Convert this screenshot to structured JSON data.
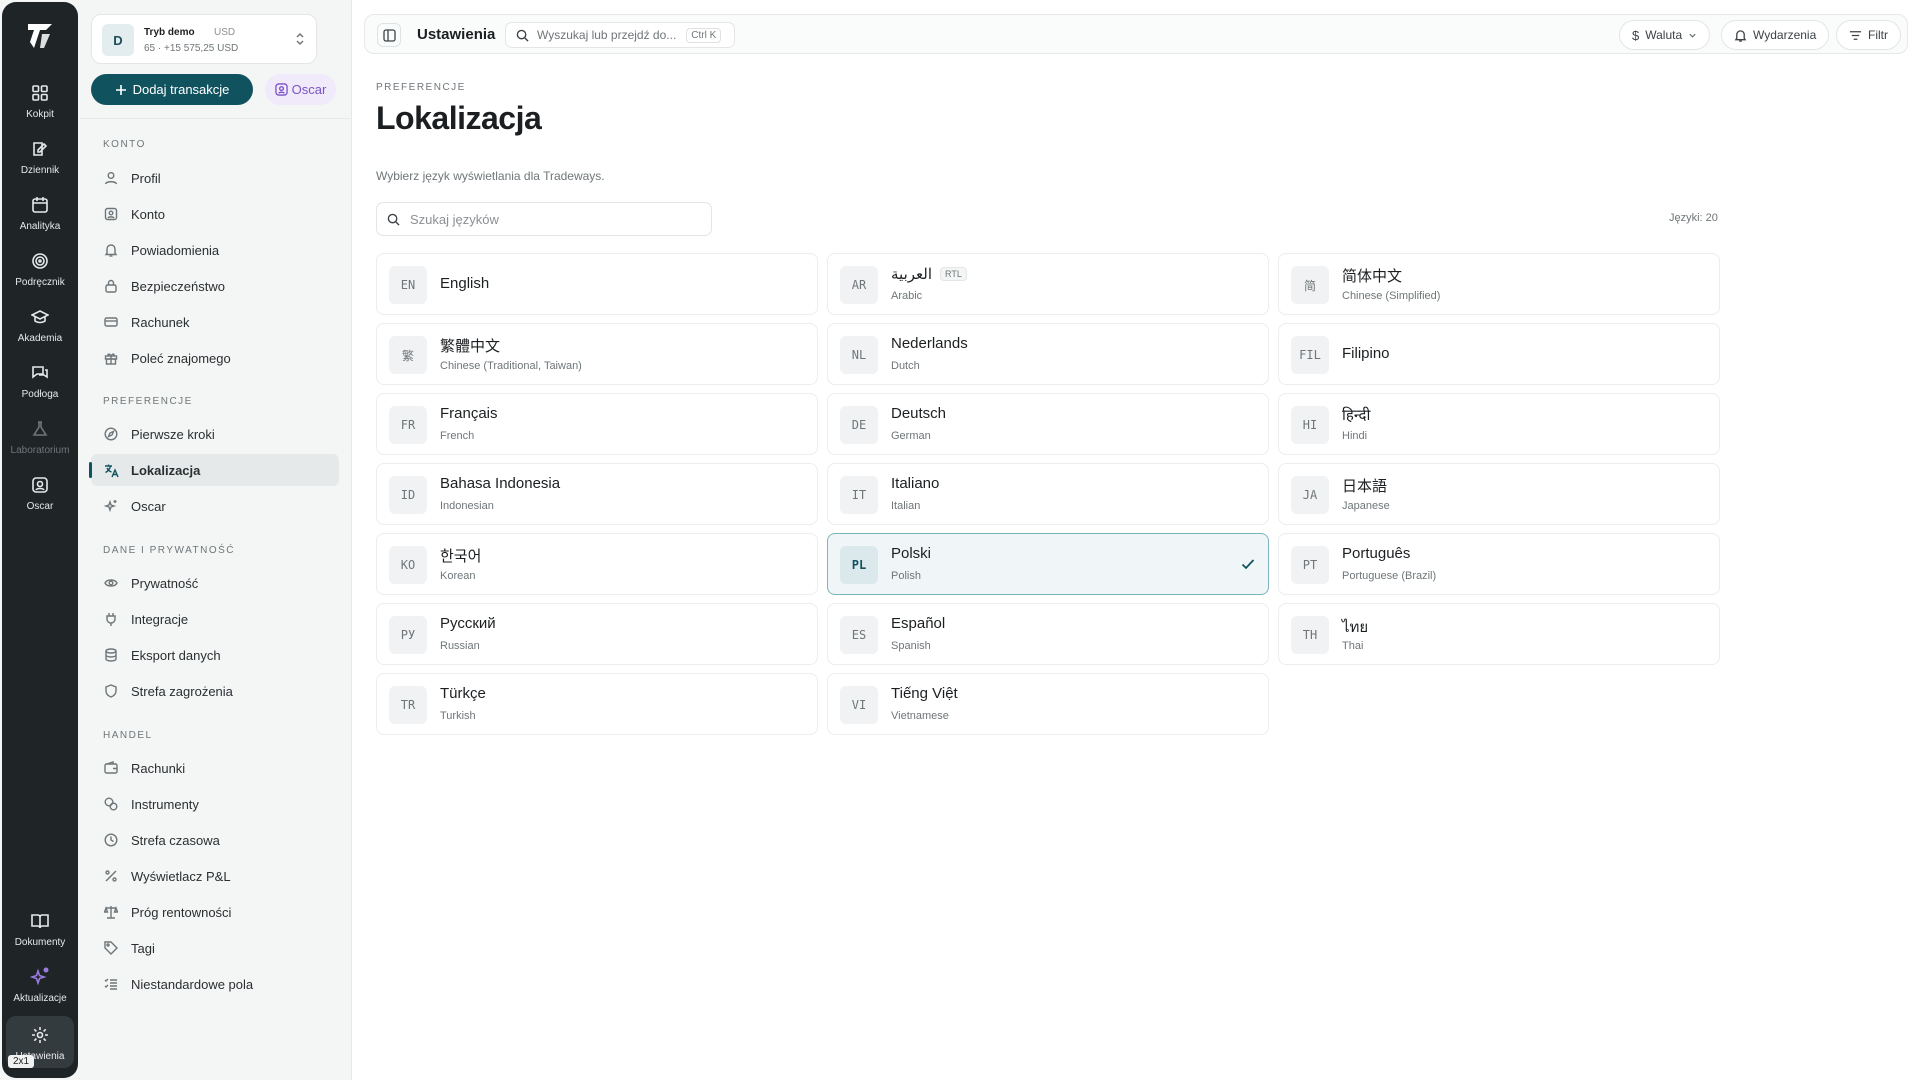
{
  "rail": {
    "items": [
      {
        "label": "Kokpit",
        "icon": "grid-icon"
      },
      {
        "label": "Dziennik",
        "icon": "journal-icon"
      },
      {
        "label": "Analityka",
        "icon": "calendar-chart-icon"
      },
      {
        "label": "Podręcznik",
        "icon": "target-icon"
      },
      {
        "label": "Akademia",
        "icon": "graduation-cap-icon"
      },
      {
        "label": "Podłoga",
        "icon": "chat-icon"
      },
      {
        "label": "Laboratorium",
        "icon": "flask-icon"
      },
      {
        "label": "Oscar",
        "icon": "bot-icon"
      }
    ],
    "bottom": [
      {
        "label": "Dokumenty",
        "icon": "book-icon"
      },
      {
        "label": "Aktualizacje",
        "icon": "sparkle-icon"
      },
      {
        "label": "Ustawienia",
        "icon": "gear-icon"
      }
    ],
    "badge": "2x1"
  },
  "account": {
    "avatar": "D",
    "mode": "Tryb demo",
    "currency": "USD",
    "summary": "65 · +15 575,25 USD"
  },
  "actions": {
    "add_transaction": "Dodaj transakcje",
    "oscar": "Oscar"
  },
  "sidebar": {
    "sections": [
      {
        "title": "KONTO",
        "items": [
          {
            "label": "Profil",
            "icon": "user-icon"
          },
          {
            "label": "Konto",
            "icon": "id-card-icon"
          },
          {
            "label": "Powiadomienia",
            "icon": "bell-icon"
          },
          {
            "label": "Bezpieczeństwo",
            "icon": "lock-icon"
          },
          {
            "label": "Rachunek",
            "icon": "card-icon"
          },
          {
            "label": "Poleć znajomego",
            "icon": "gift-icon"
          }
        ]
      },
      {
        "title": "PREFERENCJE",
        "items": [
          {
            "label": "Pierwsze kroki",
            "icon": "compass-icon"
          },
          {
            "label": "Lokalizacja",
            "icon": "translate-icon"
          },
          {
            "label": "Oscar",
            "icon": "sparkles-icon"
          }
        ]
      },
      {
        "title": "DANE I PRYWATNOŚĆ",
        "items": [
          {
            "label": "Prywatność",
            "icon": "eye-icon"
          },
          {
            "label": "Integracje",
            "icon": "plug-icon"
          },
          {
            "label": "Eksport danych",
            "icon": "database-icon"
          },
          {
            "label": "Strefa zagrożenia",
            "icon": "shield-icon"
          }
        ]
      },
      {
        "title": "HANDEL",
        "items": [
          {
            "label": "Rachunki",
            "icon": "wallet-icon"
          },
          {
            "label": "Instrumenty",
            "icon": "coins-icon"
          },
          {
            "label": "Strefa czasowa",
            "icon": "clock-icon"
          },
          {
            "label": "Wyświetlacz P&L",
            "icon": "percent-icon"
          },
          {
            "label": "Próg rentowności",
            "icon": "scale-icon"
          },
          {
            "label": "Tagi",
            "icon": "tag-icon"
          },
          {
            "label": "Niestandardowe pola",
            "icon": "list-checks-icon"
          }
        ]
      }
    ]
  },
  "topbar": {
    "title": "Ustawienia",
    "search_placeholder": "Wyszukaj lub przejdź do...",
    "shortcut": "Ctrl K",
    "currency_btn": "Waluta",
    "events_btn": "Wydarzenia",
    "filter_btn": "Filtr"
  },
  "page": {
    "eyebrow": "PREFERENCJE",
    "title": "Lokalizacja",
    "description": "Wybierz język wyświetlania dla Tradeways.",
    "search_placeholder": "Szukaj języków",
    "count": "Języki: 20"
  },
  "languages": [
    {
      "code": "EN",
      "name": "English",
      "sub": ""
    },
    {
      "code": "AR",
      "name": "العربية",
      "sub": "Arabic",
      "rtl": "RTL"
    },
    {
      "code": "简",
      "name": "简体中文",
      "sub": "Chinese (Simplified)"
    },
    {
      "code": "繁",
      "name": "繁體中文",
      "sub": "Chinese (Traditional, Taiwan)"
    },
    {
      "code": "NL",
      "name": "Nederlands",
      "sub": "Dutch"
    },
    {
      "code": "FIL",
      "name": "Filipino",
      "sub": ""
    },
    {
      "code": "FR",
      "name": "Français",
      "sub": "French"
    },
    {
      "code": "DE",
      "name": "Deutsch",
      "sub": "German"
    },
    {
      "code": "HI",
      "name": "हिन्दी",
      "sub": "Hindi"
    },
    {
      "code": "ID",
      "name": "Bahasa Indonesia",
      "sub": "Indonesian"
    },
    {
      "code": "IT",
      "name": "Italiano",
      "sub": "Italian"
    },
    {
      "code": "JA",
      "name": "日本語",
      "sub": "Japanese"
    },
    {
      "code": "KO",
      "name": "한국어",
      "sub": "Korean"
    },
    {
      "code": "PL",
      "name": "Polski",
      "sub": "Polish",
      "selected": true
    },
    {
      "code": "PT",
      "name": "Português",
      "sub": "Portuguese (Brazil)"
    },
    {
      "code": "РУ",
      "name": "Русский",
      "sub": "Russian"
    },
    {
      "code": "ES",
      "name": "Español",
      "sub": "Spanish"
    },
    {
      "code": "TH",
      "name": "ไทย",
      "sub": "Thai"
    },
    {
      "code": "TR",
      "name": "Türkçe",
      "sub": "Turkish"
    },
    {
      "code": "VI",
      "name": "Tiếng Việt",
      "sub": "Vietnamese"
    }
  ],
  "colors": {
    "accent": "#10535f",
    "rail_bg": "#1f2427",
    "oscar": "#7a52c7"
  }
}
